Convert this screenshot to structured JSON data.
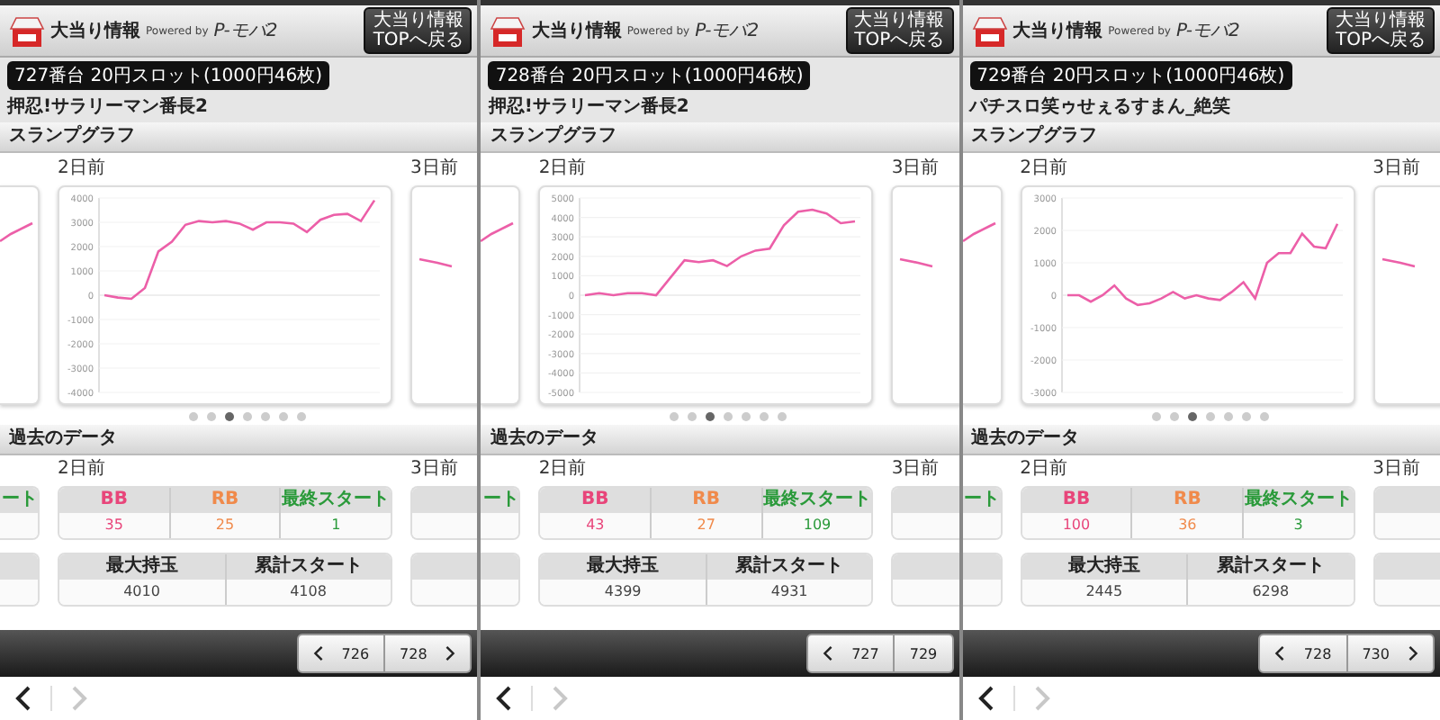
{
  "panels": [
    {
      "header": {
        "title": "大当り情報",
        "powered_by": "Powered by",
        "brand": "P-モバ2",
        "top_button": "大当り情報\nTOPへ戻る"
      },
      "machine": {
        "badge": "727番台 20円スロット(1000円46枚)",
        "name": "押忍!サラリーマン番長2"
      },
      "slump": {
        "heading": "スランプグラフ",
        "day_label": "2日前",
        "next_day_label": "3日前",
        "chart_data": {
          "type": "line",
          "grid": true,
          "ylim": [
            -4000,
            4000
          ],
          "yticks": [
            4000,
            3000,
            2000,
            1000,
            0,
            -1000,
            -2000,
            -3000,
            -4000
          ],
          "values": [
            0,
            -100,
            -150,
            300,
            1800,
            2200,
            2900,
            3050,
            3000,
            3050,
            2950,
            2700,
            3000,
            3000,
            2950,
            2600,
            3100,
            3300,
            3350,
            3050,
            3900
          ]
        },
        "dots": [
          {
            "selected": false
          },
          {
            "selected": false
          },
          {
            "selected": true
          },
          {
            "selected": false
          },
          {
            "selected": false
          },
          {
            "selected": false
          },
          {
            "selected": false
          }
        ]
      },
      "history": {
        "heading": "過去のデータ",
        "day_label": "2日前",
        "next_day_label": "3日前",
        "prev_fragment": "ート",
        "counts": {
          "columns": [
            {
              "label": "BB",
              "kind": "bb"
            },
            {
              "label": "RB",
              "kind": "rb"
            },
            {
              "label": "最終スタート",
              "kind": "start"
            }
          ],
          "values": [
            "35",
            "25",
            "1"
          ]
        },
        "totals": {
          "columns": [
            "最大持玉",
            "累計スタート"
          ],
          "values": [
            "4010",
            "4108"
          ]
        }
      },
      "pager": {
        "prev": "726",
        "next": "728",
        "next_arrow": true
      },
      "nav": {
        "back_disabled": false,
        "forward_disabled": true
      }
    },
    {
      "header": {
        "title": "大当り情報",
        "powered_by": "Powered by",
        "brand": "P-モバ2",
        "top_button": "大当り情報\nTOPへ戻る"
      },
      "machine": {
        "badge": "728番台 20円スロット(1000円46枚)",
        "name": "押忍!サラリーマン番長2"
      },
      "slump": {
        "heading": "スランプグラフ",
        "day_label": "2日前",
        "next_day_label": "3日前",
        "chart_data": {
          "type": "line",
          "grid": true,
          "ylim": [
            -5000,
            5000
          ],
          "yticks": [
            5000,
            4000,
            3000,
            2000,
            1000,
            0,
            -1000,
            -2000,
            -3000,
            -4000,
            -5000
          ],
          "values": [
            0,
            100,
            0,
            100,
            100,
            0,
            900,
            1800,
            1700,
            1800,
            1500,
            2000,
            2300,
            2400,
            3600,
            4300,
            4400,
            4200,
            3700,
            3800
          ]
        },
        "dots": [
          {
            "selected": false
          },
          {
            "selected": false
          },
          {
            "selected": true
          },
          {
            "selected": false
          },
          {
            "selected": false
          },
          {
            "selected": false
          },
          {
            "selected": false
          }
        ]
      },
      "history": {
        "heading": "過去のデータ",
        "day_label": "2日前",
        "next_day_label": "3日前",
        "prev_fragment": "ート",
        "counts": {
          "columns": [
            {
              "label": "BB",
              "kind": "bb"
            },
            {
              "label": "RB",
              "kind": "rb"
            },
            {
              "label": "最終スタート",
              "kind": "start"
            }
          ],
          "values": [
            "43",
            "27",
            "109"
          ]
        },
        "totals": {
          "columns": [
            "最大持玉",
            "累計スタート"
          ],
          "values": [
            "4399",
            "4931"
          ]
        }
      },
      "pager": {
        "prev": "727",
        "next": "729",
        "next_arrow": false
      },
      "nav": {
        "back_disabled": false,
        "forward_disabled": true
      }
    },
    {
      "header": {
        "title": "大当り情報",
        "powered_by": "Powered by",
        "brand": "P-モバ2",
        "top_button": "大当り情報\nTOPへ戻る"
      },
      "machine": {
        "badge": "729番台 20円スロット(1000円46枚)",
        "name": "パチスロ笑ゥせぇるすまん_絶笑"
      },
      "slump": {
        "heading": "スランプグラフ",
        "day_label": "2日前",
        "next_day_label": "3日前",
        "chart_data": {
          "type": "line",
          "grid": true,
          "ylim": [
            -3000,
            3000
          ],
          "yticks": [
            3000,
            2000,
            1000,
            0,
            -1000,
            -2000,
            -3000
          ],
          "values": [
            0,
            0,
            -200,
            0,
            300,
            -100,
            -300,
            -250,
            -100,
            100,
            -100,
            0,
            -100,
            -150,
            100,
            400,
            -100,
            1000,
            1300,
            1300,
            1900,
            1500,
            1450,
            2200
          ]
        },
        "dots": [
          {
            "selected": false
          },
          {
            "selected": false
          },
          {
            "selected": true
          },
          {
            "selected": false
          },
          {
            "selected": false
          },
          {
            "selected": false
          },
          {
            "selected": false
          }
        ]
      },
      "history": {
        "heading": "過去のデータ",
        "day_label": "2日前",
        "next_day_label": "3日前",
        "prev_fragment": "ート",
        "counts": {
          "columns": [
            {
              "label": "BB",
              "kind": "bb"
            },
            {
              "label": "RB",
              "kind": "rb"
            },
            {
              "label": "最終スタート",
              "kind": "start"
            }
          ],
          "values": [
            "100",
            "36",
            "3"
          ]
        },
        "totals": {
          "columns": [
            "最大持玉",
            "累計スタート"
          ],
          "values": [
            "2445",
            "6298"
          ]
        }
      },
      "pager": {
        "prev": "728",
        "next": "730",
        "next_arrow": true
      },
      "nav": {
        "back_disabled": false,
        "forward_disabled": true
      }
    }
  ]
}
